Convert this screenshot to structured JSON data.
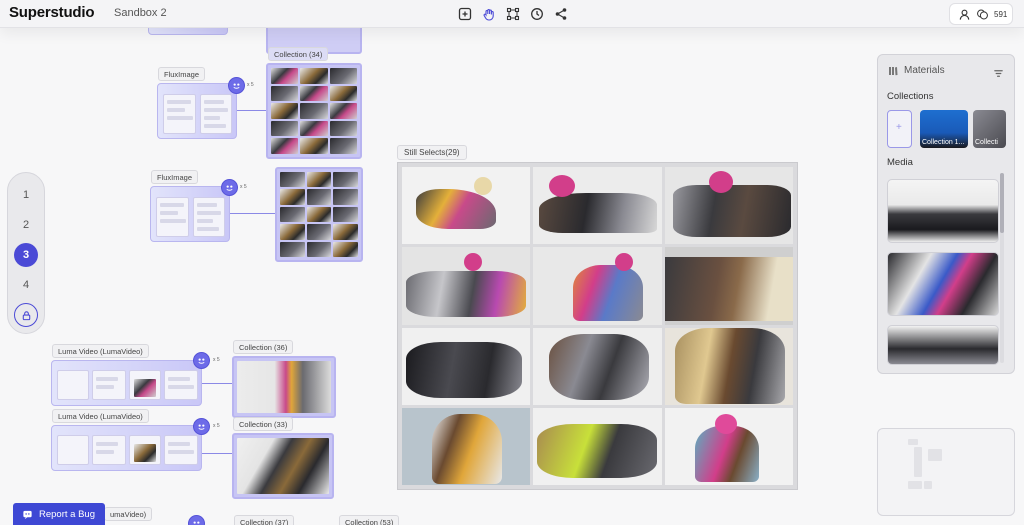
{
  "app": {
    "name": "Superstudio",
    "project": "Sandbox 2"
  },
  "toolbar": {
    "tools": [
      "add-frame-icon",
      "hand-icon",
      "connect-icon",
      "history-icon",
      "share-icon"
    ]
  },
  "account": {
    "credits": "591"
  },
  "stages": [
    "1",
    "2",
    "3",
    "4"
  ],
  "active_stage": "3",
  "nodes": [
    {
      "label": "FluxImage",
      "count": "x 5"
    },
    {
      "label": "FluxImage",
      "count": "x 5"
    },
    {
      "label": "Luma Video (LumaVideo)",
      "count": "x 5"
    },
    {
      "label": "Luma Video (LumaVideo)",
      "count": "x 5"
    },
    {
      "label": "umaVideo)"
    }
  ],
  "collections": [
    {
      "label": "Collection (34)"
    },
    {
      "label": "Collection (36)"
    },
    {
      "label": "Collection (33)"
    },
    {
      "label": "Collection (37)"
    },
    {
      "label": "Collection (53)"
    }
  ],
  "still_selects": {
    "label": "Still Selects(29)"
  },
  "materials": {
    "title": "Materials",
    "collections_heading": "Collections",
    "media_heading": "Media",
    "collection_items": [
      "Collection 1...",
      "Collecti"
    ]
  },
  "report_bug": {
    "label": "Report a Bug"
  },
  "colors": {
    "accent": "#4b4ad6",
    "node": "#c9c7f7",
    "bug": "#3e48d4"
  }
}
